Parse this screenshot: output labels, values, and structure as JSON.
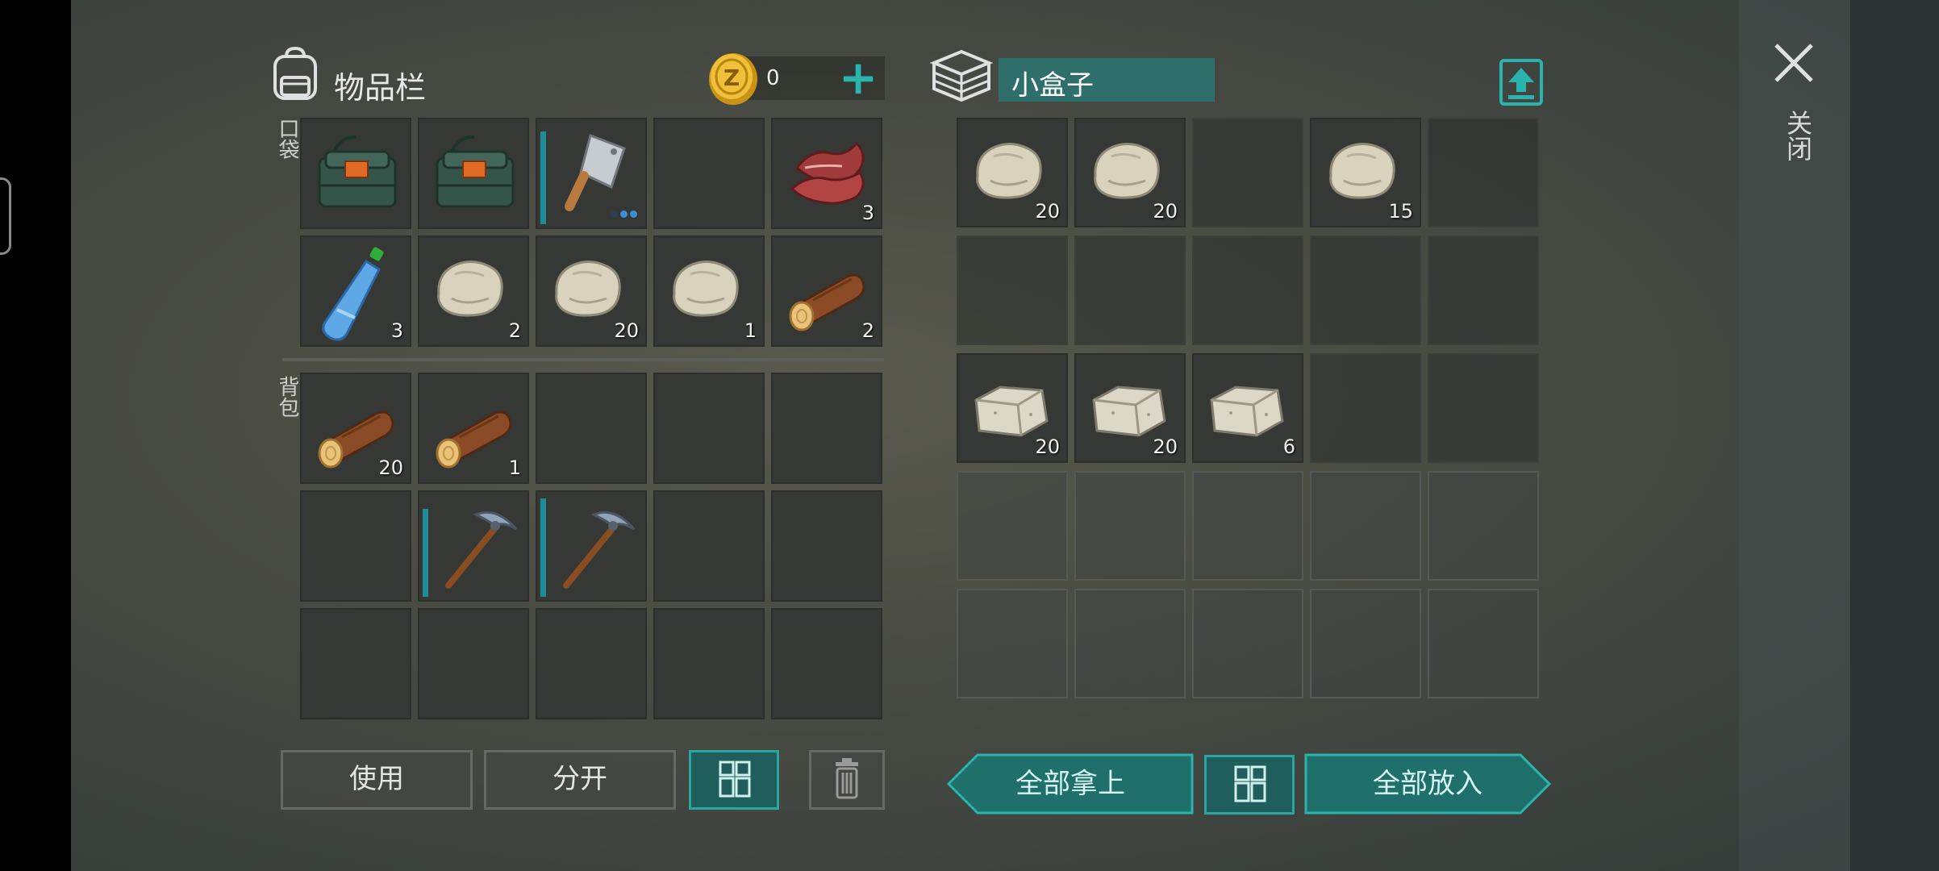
{
  "header": {
    "inventory_title": "物品栏",
    "coins": "0",
    "add_label": "+",
    "pocket_label": "口袋",
    "backpack_label": "背包"
  },
  "container": {
    "name": "小盒子",
    "close_label": "关闭"
  },
  "pocket_slots": [
    {
      "item": "military-bag-icon",
      "qty": ""
    },
    {
      "item": "military-bag-icon",
      "qty": ""
    },
    {
      "item": "cleaver-icon",
      "qty": "",
      "durability": 0.9
    },
    {
      "item": "",
      "qty": ""
    },
    {
      "item": "raw-meat-icon",
      "qty": "3"
    },
    {
      "item": "water-bottle-icon",
      "qty": "3"
    },
    {
      "item": "stone-icon",
      "qty": "2"
    },
    {
      "item": "stone-icon",
      "qty": "20"
    },
    {
      "item": "stone-icon",
      "qty": "1"
    },
    {
      "item": "log-icon",
      "qty": "2"
    }
  ],
  "backpack_slots": [
    {
      "item": "log-icon",
      "qty": "20"
    },
    {
      "item": "log-icon",
      "qty": "1"
    },
    {
      "item": "",
      "qty": ""
    },
    {
      "item": "",
      "qty": ""
    },
    {
      "item": "",
      "qty": ""
    },
    {
      "item": "",
      "qty": ""
    },
    {
      "item": "pickaxe-icon",
      "qty": "",
      "durability": 0.85
    },
    {
      "item": "pickaxe-icon",
      "qty": "",
      "durability": 0.95
    },
    {
      "item": "",
      "qty": ""
    },
    {
      "item": "",
      "qty": ""
    },
    {
      "item": "",
      "qty": ""
    },
    {
      "item": "",
      "qty": ""
    },
    {
      "item": "",
      "qty": ""
    },
    {
      "item": "",
      "qty": ""
    },
    {
      "item": "",
      "qty": ""
    }
  ],
  "box_slots": [
    {
      "item": "stone-icon",
      "qty": "20"
    },
    {
      "item": "stone-icon",
      "qty": "20"
    },
    {
      "item": "",
      "qty": ""
    },
    {
      "item": "stone-icon",
      "qty": "15"
    },
    {
      "item": "",
      "qty": ""
    },
    {
      "item": "",
      "qty": ""
    },
    {
      "item": "",
      "qty": ""
    },
    {
      "item": "",
      "qty": ""
    },
    {
      "item": "",
      "qty": ""
    },
    {
      "item": "",
      "qty": ""
    },
    {
      "item": "stone-block-icon",
      "qty": "20"
    },
    {
      "item": "stone-block-icon",
      "qty": "20"
    },
    {
      "item": "stone-block-icon",
      "qty": "6"
    },
    {
      "item": "",
      "qty": ""
    },
    {
      "item": "",
      "qty": ""
    },
    {
      "item": "",
      "qty": "",
      "locked": true
    },
    {
      "item": "",
      "qty": "",
      "locked": true
    },
    {
      "item": "",
      "qty": "",
      "locked": true
    },
    {
      "item": "",
      "qty": "",
      "locked": true
    },
    {
      "item": "",
      "qty": "",
      "locked": true
    },
    {
      "item": "",
      "qty": "",
      "locked": true
    },
    {
      "item": "",
      "qty": "",
      "locked": true
    },
    {
      "item": "",
      "qty": "",
      "locked": true
    },
    {
      "item": "",
      "qty": "",
      "locked": true
    },
    {
      "item": "",
      "qty": "",
      "locked": true
    }
  ],
  "buttons": {
    "use": "使用",
    "split": "分开",
    "take_all": "全部拿上",
    "put_all": "全部放入"
  },
  "colors": {
    "accent": "#2aa59f",
    "accent_dark": "#1f5e5c",
    "box_name_bg": "#2e6f6c"
  }
}
